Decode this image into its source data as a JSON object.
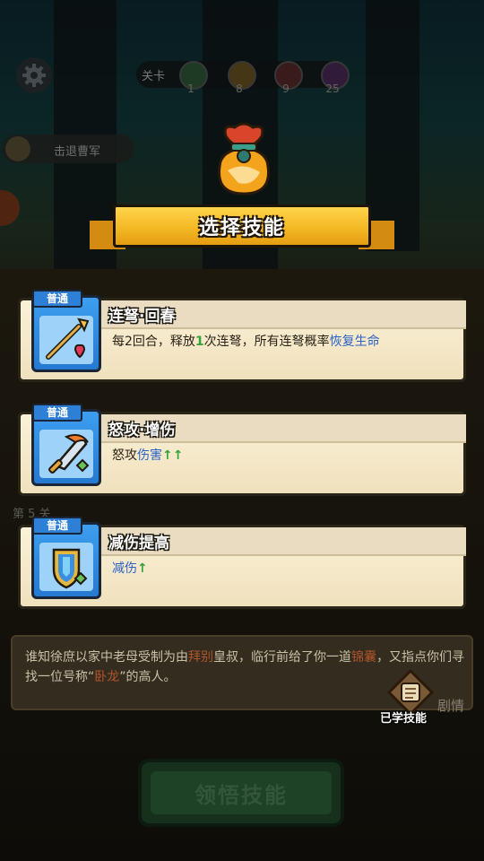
{
  "hud": {
    "stage_label": "关卡",
    "stage_nodes": [
      "1",
      "8",
      "9",
      "25"
    ],
    "retreat_label": "击退曹军"
  },
  "dialog": {
    "title": "选择技能",
    "skills": [
      {
        "rank": "普通",
        "name": "连弩·回春",
        "desc_parts": [
          "每2回合，释放",
          "1",
          "次连弩，所有连弩概率",
          "恢复生命"
        ],
        "icon": "crossbow-bolt-heart-icon"
      },
      {
        "rank": "普通",
        "name": "怒攻·增伤",
        "desc_parts": [
          "怒攻",
          "伤害",
          "↑↑"
        ],
        "icon": "flaming-sword-icon"
      },
      {
        "rank": "普通",
        "name": "减伤提高",
        "desc_parts": [
          "减伤",
          "↑"
        ],
        "icon": "shield-icon"
      }
    ]
  },
  "behind": {
    "stage5": "第 5 关"
  },
  "story": {
    "parts": [
      "谁知徐庶以家中老母受制为由",
      "拜别",
      "皇叔，临行前给了你一道",
      "锦囊",
      "，又指点你们寻找一位号称“",
      "卧龙",
      "”的高人。"
    ],
    "tab": "剧情"
  },
  "learned_label": "已学技能",
  "learn_button": "领悟技能",
  "colors": {
    "ribbon": "#f3b623",
    "card_bg": "#f6ebcb",
    "rank_blue": "#2e7fd6",
    "highlight_blue": "#2a62c8",
    "highlight_green": "#33a33a"
  }
}
